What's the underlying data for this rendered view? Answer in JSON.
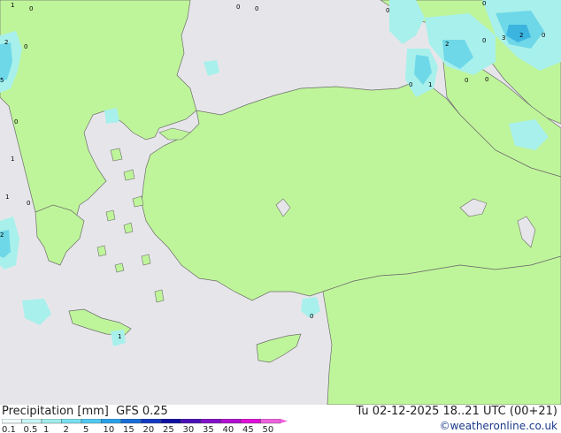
{
  "map": {
    "precip_labels": [
      "1",
      "0",
      "2",
      "0",
      "5",
      "0",
      "1",
      "1",
      "0",
      "2",
      "0",
      "0",
      "0",
      "1",
      "0",
      "0",
      "3",
      "2",
      "0",
      "0",
      "2",
      "0",
      "0",
      "1",
      "0"
    ],
    "colors": {
      "sea": "#e6e6ea",
      "land": "#bff59a",
      "coast": "#6c6c6c",
      "precip_light": "#a8f0ec",
      "precip_medium": "#6ed8e8",
      "precip_heavy": "#3cb4e0"
    }
  },
  "footer": {
    "title_left": "Precipitation [mm]  GFS 0.25",
    "title_right": "Tu 02-12-2025 18..21 UTC (00+21)",
    "credit": "©weatheronline.co.uk",
    "legend_values": [
      "0.1",
      "0.5",
      "1",
      "2",
      "5",
      "10",
      "15",
      "20",
      "25",
      "30",
      "35",
      "40",
      "45",
      "50"
    ],
    "legend_colors": [
      "#f0fbfb",
      "#c8f4f4",
      "#a0ecec",
      "#78e0f0",
      "#50c8f0",
      "#28a0e8",
      "#1a6cd8",
      "#1438c0",
      "#1010a0",
      "#4a10b8",
      "#8010c8",
      "#b010d0",
      "#e010d8",
      "#f060e0"
    ]
  }
}
